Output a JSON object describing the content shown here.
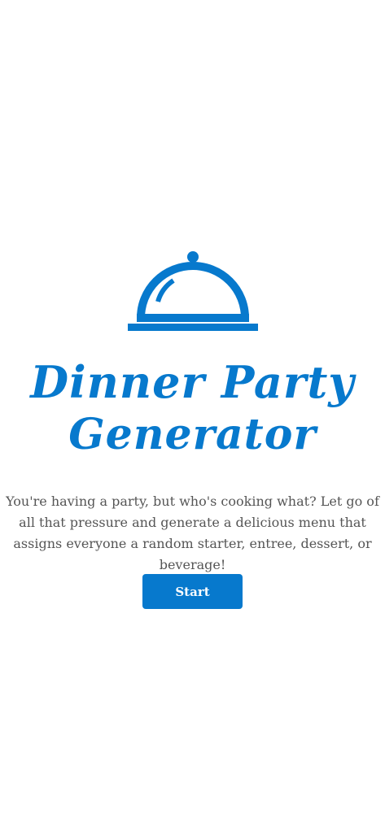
{
  "colors": {
    "accent": "#0779cd",
    "text": "#555555",
    "background": "#ffffff",
    "button_text": "#ffffff"
  },
  "logo": {
    "icon": "serving-cloche-icon"
  },
  "title": {
    "line1": "Dinner Party",
    "line2": "Generator"
  },
  "description": "You're having a party, but who's cooking what? Let go of all that pressure and generate a delicious menu that assigns everyone a random starter, entree, dessert, or beverage!",
  "start_button": {
    "label": "Start"
  }
}
